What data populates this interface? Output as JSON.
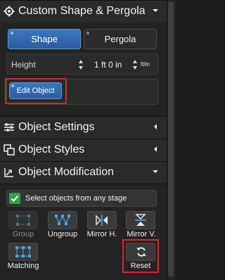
{
  "panel": {
    "title": "Custom Shape & Pergola",
    "tabs": [
      "Shape",
      "Pergola"
    ],
    "height_label": "Height",
    "height_value": "1 ft 0 in",
    "unit_toggle": "ft/in",
    "edit_object": "Edit Object"
  },
  "sections": {
    "object_settings": "Object Settings",
    "object_styles": "Object Styles",
    "object_modification": "Object Modification"
  },
  "modification": {
    "select_any_stage": "Select objects from any stage",
    "tools": {
      "group": "Group",
      "ungroup": "Ungroup",
      "mirror_h": "Mirror H.",
      "mirror_v": "Mirror V.",
      "matching": "Matching",
      "reset": "Reset"
    }
  },
  "colors": {
    "accent_blue": "#2f6bb0",
    "check_green": "#2fa24a",
    "highlight_red": "#e0202b",
    "tool_icon_blue": "#3fa9e6"
  }
}
